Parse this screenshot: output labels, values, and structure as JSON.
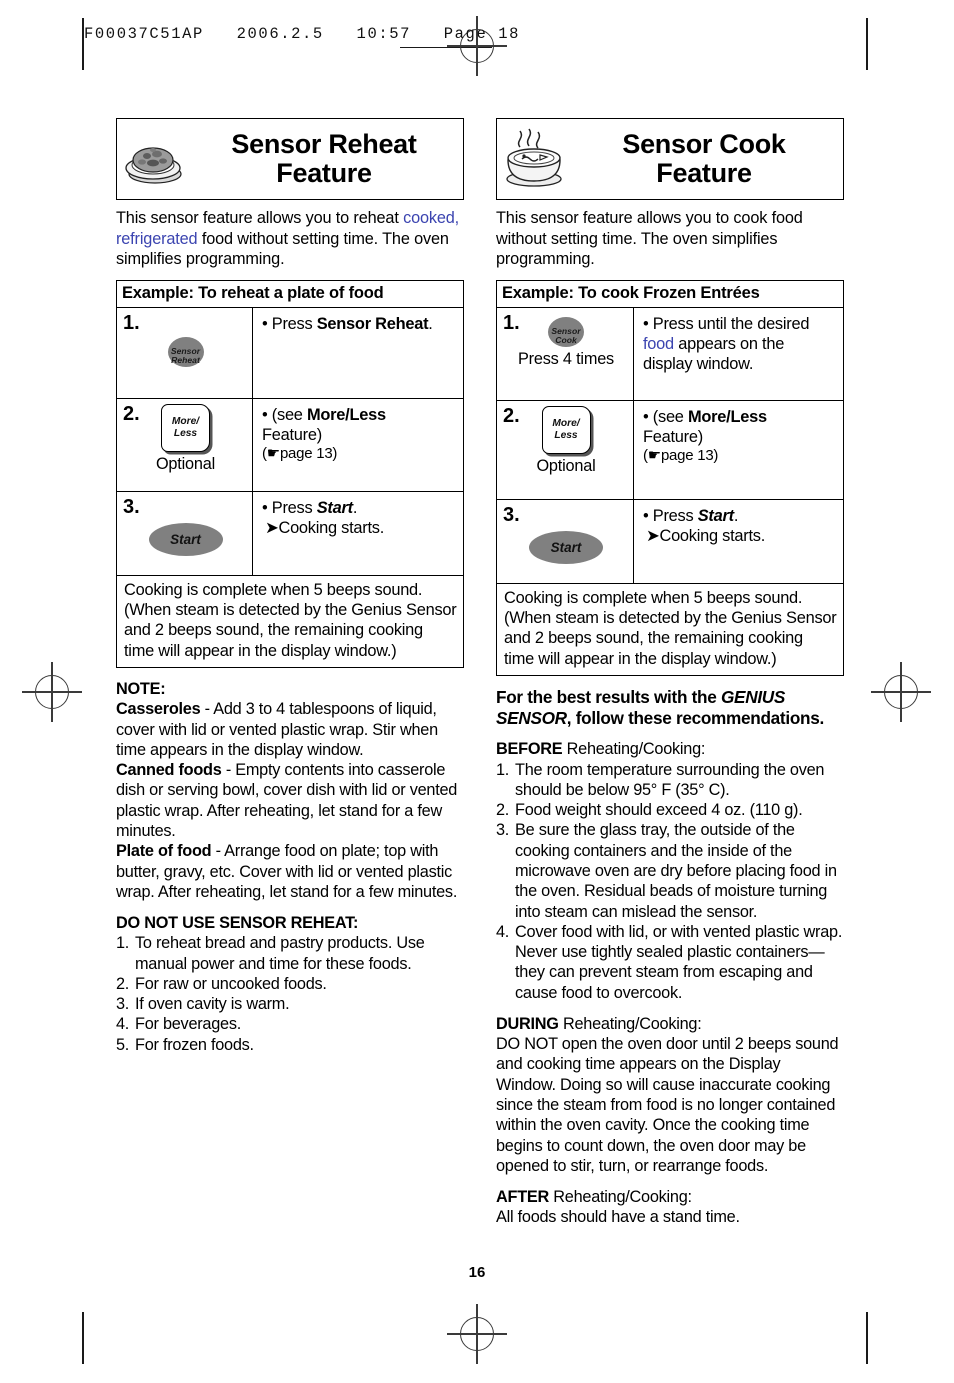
{
  "print_slug": "F00037C51AP   2006.2.5   10:57   Page 18",
  "page_number": "16",
  "colors": {
    "link_blue": "#3b44b0",
    "button_grey": "#808080"
  },
  "left_column": {
    "banner": {
      "icon": "plate-of-food-icon",
      "title_line1": "Sensor Reheat",
      "title_line2": "Feature"
    },
    "intro": {
      "part1": "This sensor feature allows you to reheat ",
      "highlight": "cooked, refrigerated",
      "part2": " food without setting time. The oven simplifies programming."
    },
    "example_caption": "Example: To reheat a plate of food",
    "steps": [
      {
        "number": "1.",
        "button_label_line1": "Sensor",
        "button_label_line2": "Reheat",
        "button_caption": "",
        "instruction_bullet": "• Press ",
        "instruction_bold": "Sensor Reheat",
        "instruction_tail": "."
      },
      {
        "number": "2.",
        "button_label_line1": "More/",
        "button_label_line2": "Less",
        "button_caption": "Optional",
        "line1_prefix": "• (see ",
        "line1_bold": "More/Less",
        "line2": "Feature)",
        "line3": "(☛page 13)"
      },
      {
        "number": "3.",
        "button_label": "Start",
        "line1_prefix": "• Press ",
        "line1_bold": "Start",
        "line1_tail": ".",
        "line2": "➤Cooking starts."
      }
    ],
    "result_note": "Cooking is complete when 5 beeps sound. (When steam is detected by the Genius Sensor and 2 beeps sound, the remaining cooking time will appear in the display window.)",
    "note_heading": "NOTE:",
    "note_items": [
      {
        "term": "Casseroles",
        "text": " - Add 3 to 4 tablespoons of liquid, cover with lid or vented plastic wrap. Stir when time appears in the display window."
      },
      {
        "term": "Canned foods",
        "text": " - Empty contents into casserole dish or serving bowl, cover dish with lid or vented plastic wrap. After reheating, let stand for a few minutes."
      },
      {
        "term": "Plate of food",
        "text": " - Arrange food on plate; top with butter, gravy, etc. Cover with lid or vented plastic wrap. After reheating, let stand for a few minutes."
      }
    ],
    "donot_heading": "DO NOT USE SENSOR REHEAT:",
    "donot_items": [
      {
        "n": "1.",
        "t": "To reheat bread and pastry products. Use manual power and time for these foods."
      },
      {
        "n": "2.",
        "t": "For raw or uncooked foods."
      },
      {
        "n": "3.",
        "t": "If oven cavity is warm."
      },
      {
        "n": "4.",
        "t": "For beverages."
      },
      {
        "n": "5.",
        "t": "For frozen foods."
      }
    ]
  },
  "right_column": {
    "banner": {
      "icon": "steaming-bowl-icon",
      "title_line1": "Sensor Cook",
      "title_line2": "Feature"
    },
    "intro": {
      "text": "This sensor feature allows you to cook food without setting time. The oven simplifies programming."
    },
    "example_caption": "Example: To cook Frozen Entrées",
    "steps": [
      {
        "number": "1.",
        "button_label_line1": "Sensor",
        "button_label_line2": "Cook",
        "button_caption": "Press 4 times",
        "line1": "• Press until the desired",
        "highlight": "food",
        "line2_tail": " appears on the",
        "line3": "display window."
      },
      {
        "number": "2.",
        "button_label_line1": "More/",
        "button_label_line2": "Less",
        "button_caption": "Optional",
        "line1_prefix": "• (see ",
        "line1_bold": "More/Less",
        "line2": "Feature)",
        "line3": "(☛page 13)"
      },
      {
        "number": "3.",
        "button_label": "Start",
        "line1_prefix": "• Press ",
        "line1_bold": "Start",
        "line1_tail": ".",
        "line2": "➤Cooking starts."
      }
    ],
    "result_note": "Cooking is complete when 5 beeps sound. (When steam is detected by the Genius Sensor and 2 beeps sound, the remaining cooking time will appear in the display window.)",
    "best_results": {
      "line1": "For the best results with the ",
      "italic": "GENIUS SENSOR",
      "line2": ", follow these recommendations."
    },
    "before_heading_bold": "BEFORE",
    "before_heading_rest": " Reheating/Cooking:",
    "before_items": [
      {
        "n": "1.",
        "t": "The room temperature surrounding the oven should be below 95° F (35° C)."
      },
      {
        "n": "2.",
        "t": "Food weight should exceed 4 oz. (110 g)."
      },
      {
        "n": "3.",
        "t": "Be sure the glass tray, the outside of the cooking containers and the inside of the microwave oven are dry before placing food in the oven. Residual beads of moisture turning into steam can mislead the sensor."
      },
      {
        "n": "4.",
        "t": "Cover food with lid, or with vented plastic wrap. Never use tightly sealed plastic containers—they can prevent steam from escaping and cause food to overcook."
      }
    ],
    "during_heading_bold": "DURING",
    "during_heading_rest": " Reheating/Cooking:",
    "during_text": "DO NOT open the oven door until 2 beeps sound and cooking time appears on the Display Window.  Doing so will cause inaccurate cooking since the steam from food is no longer contained within the oven cavity. Once the cooking time begins to count down, the oven door may be opened to stir, turn, or rearrange foods.",
    "after_heading_bold": "AFTER",
    "after_heading_rest": " Reheating/Cooking:",
    "after_text": "All foods should have a stand time."
  }
}
